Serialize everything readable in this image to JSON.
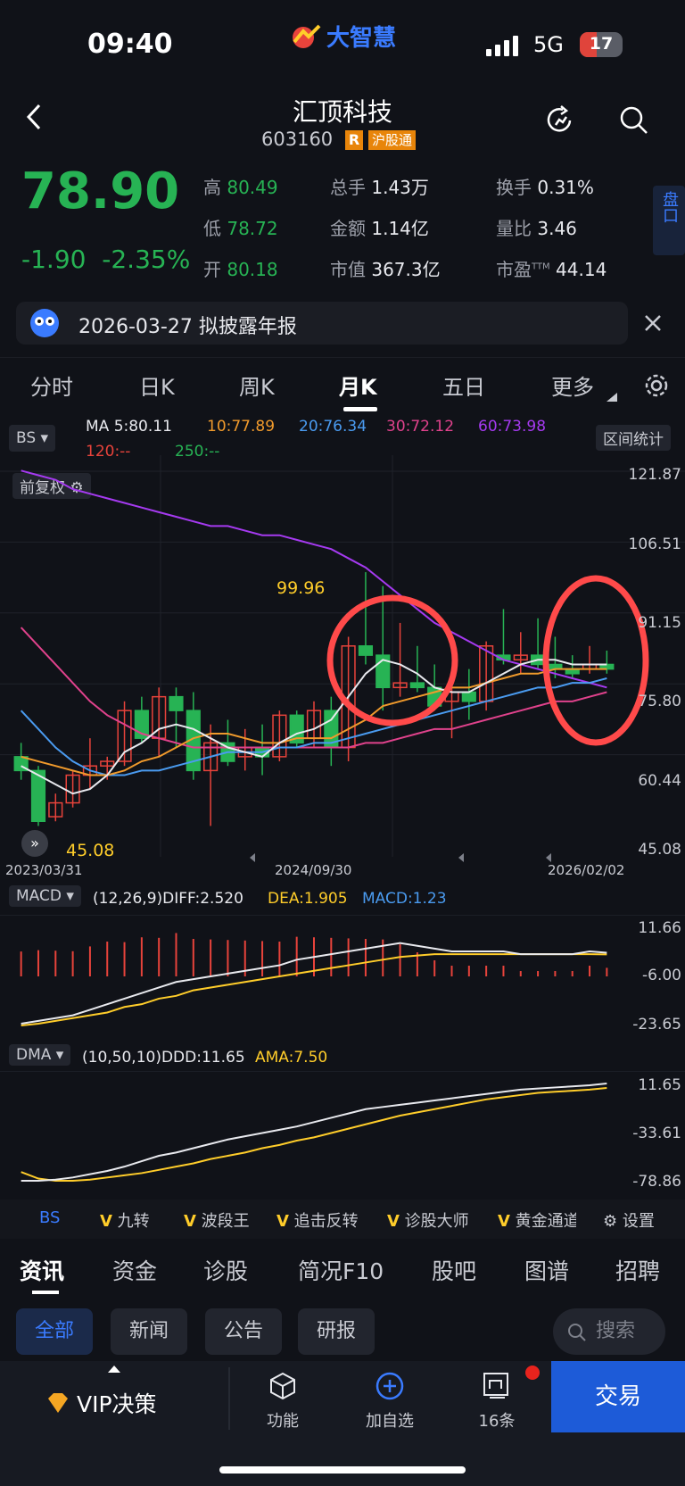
{
  "status": {
    "time": "09:40",
    "network": "5G",
    "battery": "17",
    "app_logo": "大智慧"
  },
  "header": {
    "title": "汇顶科技",
    "code": "603160",
    "badge_r": "R",
    "badge_exchange": "沪股通"
  },
  "quote": {
    "price": "78.90",
    "change": "-1.90",
    "change_pct": "-2.35%",
    "high_label": "高",
    "high": "80.49",
    "low_label": "低",
    "low": "78.72",
    "open_label": "开",
    "open": "80.18",
    "vol_label": "总手",
    "vol": "1.43万",
    "amount_label": "金额",
    "amount": "1.14亿",
    "mcap_label": "市值",
    "mcap": "367.3亿",
    "turnover_label": "换手",
    "turnover": "0.31%",
    "vol_ratio_label": "量比",
    "vol_ratio": "3.46",
    "pe_label": "市盈",
    "pe_sup": "TTM",
    "pe": "44.14",
    "pankou": "盘口"
  },
  "notice": {
    "text": "2026-03-27 拟披露年报"
  },
  "tabs": [
    "分时",
    "日K",
    "周K",
    "月K",
    "五日",
    "更多"
  ],
  "active_tab": "月K",
  "indicators": {
    "bs": "BS",
    "ma": [
      {
        "label": "MA 5:80.11",
        "color": "#e8e9ee"
      },
      {
        "label": "10:77.89",
        "color": "#f09a2c"
      },
      {
        "label": "20:76.34",
        "color": "#4a9bf0"
      },
      {
        "label": "30:72.12",
        "color": "#e0428c"
      },
      {
        "label": "60:73.98",
        "color": "#a53af0"
      },
      {
        "label": "120:--",
        "color": "#e8433b"
      },
      {
        "label": "250:--",
        "color": "#27b354"
      }
    ],
    "range_stat": "区间统计",
    "adj": "前复权"
  },
  "axis": {
    "main": [
      "121.87",
      "106.51",
      "91.15",
      "75.80",
      "60.44",
      "45.08"
    ],
    "dates": [
      "2023/03/31",
      "2024/09/30",
      "2026/02/02"
    ],
    "high_mark": "99.96",
    "low_mark": "45.08",
    "macd_label": "MACD",
    "macd_params": "(12,26,9)",
    "diff": "DIFF:2.520",
    "dea": "DEA:1.905",
    "macd_val": "MACD:1.23",
    "macd_axis": [
      "11.66",
      "-6.00",
      "-23.65"
    ],
    "dma_label": "DMA",
    "dma_params": "(10,50,10)",
    "ddd": "DDD:11.65",
    "ama": "AMA:7.50",
    "dma_axis": [
      "11.65",
      "-33.61",
      "-78.86"
    ]
  },
  "chart_data": {
    "type": "candlestick",
    "candles": [
      [
        60,
        63,
        55,
        57
      ],
      [
        57,
        58,
        45,
        46
      ],
      [
        47,
        52,
        46,
        50
      ],
      [
        50,
        57,
        49,
        56
      ],
      [
        56,
        64,
        53,
        58
      ],
      [
        58,
        60,
        55,
        59
      ],
      [
        59,
        72,
        58,
        70
      ],
      [
        70,
        73,
        63,
        64
      ],
      [
        64,
        75,
        60,
        73
      ],
      [
        73,
        75,
        62,
        70
      ],
      [
        70,
        74,
        55,
        57
      ],
      [
        57,
        67,
        45,
        63
      ],
      [
        63,
        68,
        58,
        59
      ],
      [
        60,
        66,
        57,
        62
      ],
      [
        62,
        67,
        56,
        60
      ],
      [
        60,
        70,
        59,
        69
      ],
      [
        69,
        70,
        62,
        63
      ],
      [
        64,
        72,
        62,
        70
      ],
      [
        70,
        73,
        58,
        62
      ],
      [
        62,
        86,
        59,
        84
      ],
      [
        84,
        100,
        80,
        82
      ],
      [
        82,
        97,
        70,
        75
      ],
      [
        75,
        89,
        73,
        76
      ],
      [
        76,
        84,
        74,
        75
      ],
      [
        75,
        80,
        70,
        71
      ],
      [
        72,
        78,
        64,
        74
      ],
      [
        74,
        79,
        68,
        72
      ],
      [
        72,
        85,
        70,
        84
      ],
      [
        82,
        92,
        80,
        81
      ],
      [
        81,
        87,
        78,
        82
      ],
      [
        82,
        90,
        79,
        80
      ],
      [
        80,
        86,
        77,
        79
      ],
      [
        79,
        82,
        77,
        78
      ],
      [
        79,
        84,
        78,
        80
      ],
      [
        80,
        83,
        78,
        79
      ]
    ],
    "ma5": [
      58,
      56,
      54,
      52,
      53,
      56,
      61,
      63,
      66,
      67,
      66,
      64,
      62,
      61,
      60,
      63,
      65,
      66,
      68,
      73,
      78,
      81,
      80,
      78,
      75,
      74,
      74,
      76,
      78,
      80,
      81,
      81,
      80,
      80,
      80
    ],
    "ma10": [
      60,
      59,
      58,
      57,
      56,
      56,
      57,
      59,
      60,
      62,
      64,
      65,
      65,
      64,
      63,
      63,
      64,
      64,
      64,
      66,
      68,
      71,
      72,
      73,
      74,
      75,
      75,
      76,
      77,
      78,
      78,
      79,
      79,
      79,
      79
    ],
    "ma20": [
      70,
      66,
      62,
      59,
      57,
      56,
      56,
      57,
      57,
      58,
      59,
      60,
      61,
      61,
      61,
      62,
      62,
      63,
      63,
      64,
      65,
      66,
      67,
      68,
      69,
      70,
      71,
      72,
      73,
      74,
      75,
      75,
      76,
      76,
      77
    ],
    "ma30": [
      88,
      84,
      80,
      76,
      72,
      69,
      67,
      65,
      64,
      63,
      62,
      62,
      62,
      62,
      62,
      62,
      62,
      62,
      62,
      62,
      63,
      63,
      64,
      65,
      66,
      66,
      67,
      68,
      69,
      70,
      71,
      72,
      72,
      73,
      74
    ],
    "ma60": [
      122,
      121,
      120,
      118,
      117,
      116,
      115,
      114,
      113,
      112,
      111,
      110,
      110,
      109,
      108,
      108,
      107,
      106,
      105,
      103,
      101,
      98,
      95,
      92,
      89,
      87,
      85,
      83,
      81,
      80,
      79,
      78,
      77,
      76,
      75
    ],
    "ylim": [
      45.08,
      121.87
    ],
    "macd": {
      "diff": [
        -23,
        -22,
        -21,
        -20,
        -18,
        -16,
        -14,
        -12,
        -10,
        -8,
        -7,
        -6,
        -5,
        -4,
        -3,
        -2,
        0,
        1,
        2,
        3,
        4,
        5,
        6,
        5,
        4,
        3,
        3,
        3,
        3,
        2,
        2,
        2,
        2,
        3,
        2.5
      ],
      "dea": [
        -23.65,
        -23,
        -22,
        -21,
        -20,
        -19,
        -17,
        -16,
        -14,
        -13,
        -11,
        -10,
        -9,
        -8,
        -7,
        -6,
        -5,
        -4,
        -3,
        -2,
        -1,
        0,
        1,
        1.5,
        2,
        2,
        2,
        2,
        2,
        2,
        2,
        2,
        2,
        2,
        1.9
      ],
      "ylim": [
        -23.65,
        11.66
      ]
    },
    "dma": {
      "ddd": [
        -78,
        -78,
        -77,
        -75,
        -72,
        -69,
        -65,
        -60,
        -55,
        -52,
        -48,
        -44,
        -40,
        -37,
        -34,
        -31,
        -28,
        -24,
        -20,
        -16,
        -12,
        -10,
        -8,
        -6,
        -4,
        -2,
        0,
        2,
        4,
        6,
        7,
        8,
        9,
        10,
        11.65
      ],
      "ama": [
        -70,
        -76,
        -78,
        -78,
        -77,
        -75,
        -73,
        -71,
        -68,
        -65,
        -62,
        -58,
        -55,
        -52,
        -48,
        -45,
        -41,
        -38,
        -34,
        -30,
        -26,
        -22,
        -18,
        -15,
        -12,
        -9,
        -6,
        -3,
        -1,
        1,
        3,
        4,
        5,
        6,
        7.5
      ],
      "ylim": [
        -78.86,
        11.65
      ]
    }
  },
  "strategy_bar": {
    "bs": "BS",
    "items": [
      "九转",
      "波段王",
      "追击反转",
      "诊股大师",
      "黄金通道"
    ],
    "settings": "设置"
  },
  "info_tabs": [
    "资讯",
    "资金",
    "诊股",
    "简况F10",
    "股吧",
    "图谱",
    "招聘"
  ],
  "filter_pills": [
    "全部",
    "新闻",
    "公告",
    "研报"
  ],
  "search_placeholder": "搜索",
  "bottom_nav": {
    "vip": "VIP决策",
    "func": "功能",
    "add": "加自选",
    "msg": "16条",
    "trade": "交易"
  },
  "colors": {
    "up": "#e8433b",
    "down": "#27b354",
    "accent": "#3a7bff"
  }
}
